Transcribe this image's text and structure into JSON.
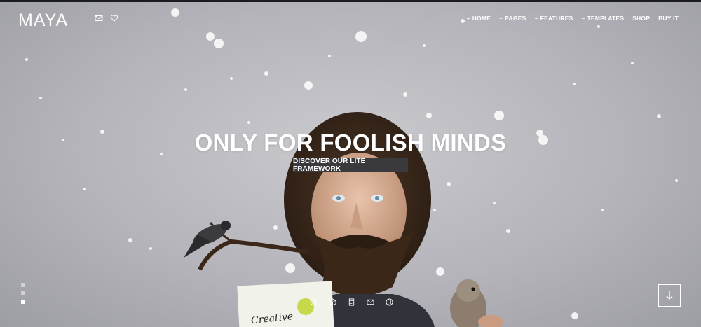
{
  "header": {
    "logo": "MAYA",
    "icons": [
      "mail-icon",
      "heart-icon"
    ]
  },
  "nav": {
    "items": [
      {
        "label": "HOME",
        "plus": "+"
      },
      {
        "label": "PAGES",
        "plus": "+"
      },
      {
        "label": "FEATURES",
        "plus": "+"
      },
      {
        "label": "TEMPLATES",
        "plus": "+"
      },
      {
        "label": "SHOP",
        "plus": ""
      },
      {
        "label": "BUY IT",
        "plus": ""
      }
    ]
  },
  "hero": {
    "title": "ONLY FOR FOOLISH MINDS",
    "cta": "DISCOVER OUR LITE FRAMEWORK",
    "slides": 3,
    "active_slide": 3,
    "socials": [
      "dribbble-icon",
      "box-icon",
      "document-icon",
      "mail-icon",
      "globe-icon"
    ],
    "scroll_icon": "arrow-down-icon"
  },
  "colors": {
    "background": "#b9b9bf",
    "text": "#ffffff",
    "cta_bg": "#3a3a3e",
    "top_bar": "#1b1c20"
  }
}
